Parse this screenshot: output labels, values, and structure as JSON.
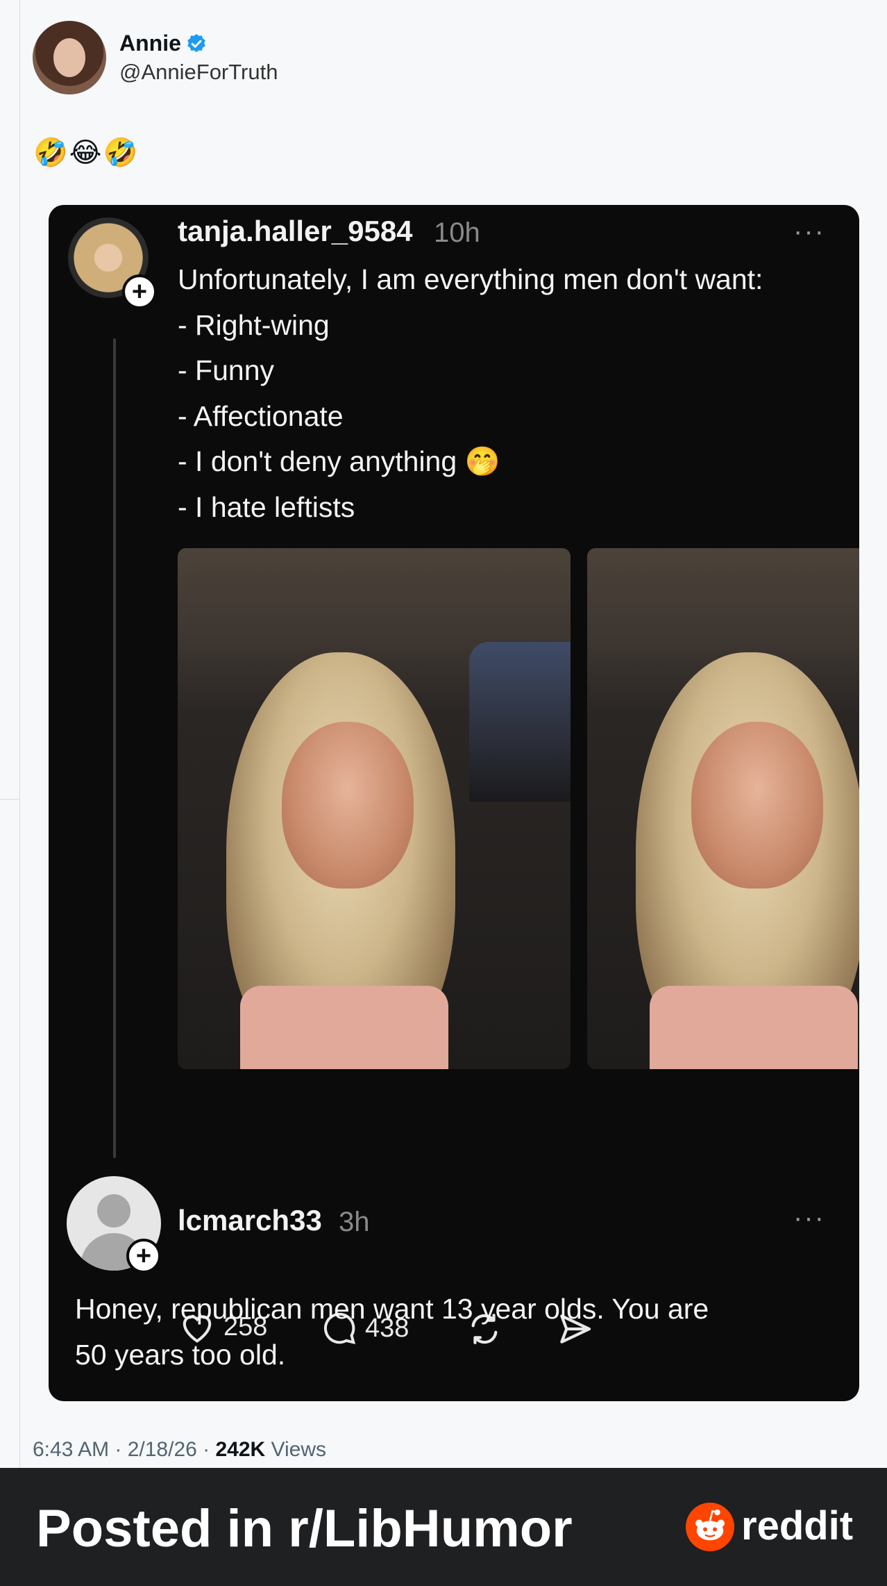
{
  "tweet": {
    "author_name": "Annie",
    "author_handle": "@AnnieForTruth",
    "body_emojis": "🤣😂🤣",
    "timestamp": "6:43 AM · 2/18/26 · ",
    "views_count": "242K",
    "views_label": " Views"
  },
  "screenshot_post": {
    "username": "tanja.haller_9584",
    "time": "10h",
    "more_label": "···",
    "lines": [
      "Unfortunately, I am everything men don't want:",
      "- Right-wing",
      "- Funny",
      "- Affectionate",
      "- I don't deny anything 🤭",
      "- I hate leftists"
    ],
    "likes": "258",
    "comments": "438",
    "plus_label": "+"
  },
  "reply": {
    "username": "lcmarch33",
    "time": "3h",
    "more_label": "···",
    "plus_label": "+",
    "lines": [
      "Honey, republican men want 13 year olds. You are",
      "50 years too old."
    ]
  },
  "banner": {
    "text": "Posted in r/LibHumor",
    "brand": "reddit"
  },
  "colors": {
    "verified": "#1d9bf0",
    "reddit_orange": "#ff4500",
    "card_bg": "#0b0b0b"
  }
}
